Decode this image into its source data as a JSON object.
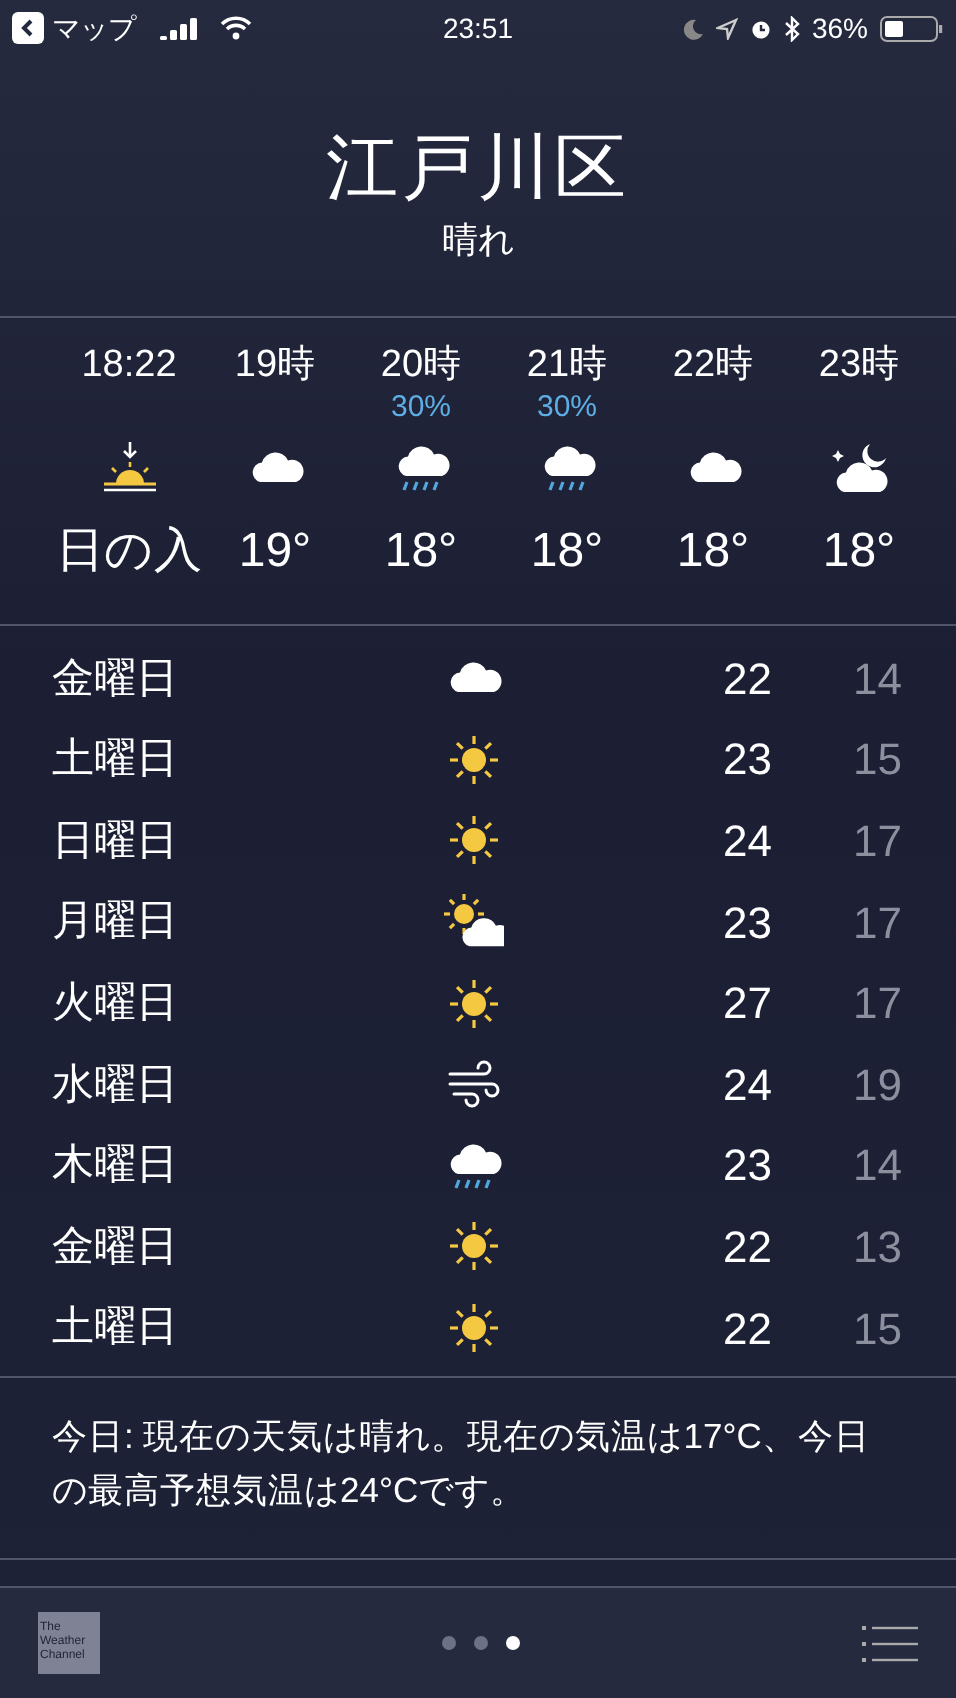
{
  "status_bar": {
    "back_label": "マップ",
    "time": "23:51",
    "battery": "36%"
  },
  "location": {
    "name": "江戸川区",
    "condition": "晴れ"
  },
  "hourly": [
    {
      "time": "18:22",
      "kind": "sunset",
      "label": "日の入"
    },
    {
      "time": "19時",
      "kind": "cloud",
      "label": "19°"
    },
    {
      "time": "20時",
      "kind": "rain",
      "label": "18°",
      "precip": "30%"
    },
    {
      "time": "21時",
      "kind": "rain",
      "label": "18°",
      "precip": "30%"
    },
    {
      "time": "22時",
      "kind": "cloud",
      "label": "18°"
    },
    {
      "time": "23時",
      "kind": "night_cloud",
      "label": "18°"
    }
  ],
  "daily": [
    {
      "day": "金曜日",
      "kind": "cloud",
      "high": "22",
      "low": "14"
    },
    {
      "day": "土曜日",
      "kind": "sun",
      "high": "23",
      "low": "15"
    },
    {
      "day": "日曜日",
      "kind": "sun",
      "high": "24",
      "low": "17"
    },
    {
      "day": "月曜日",
      "kind": "partly_sunny",
      "high": "23",
      "low": "17"
    },
    {
      "day": "火曜日",
      "kind": "sun",
      "high": "27",
      "low": "17"
    },
    {
      "day": "水曜日",
      "kind": "wind",
      "high": "24",
      "low": "19"
    },
    {
      "day": "木曜日",
      "kind": "rain",
      "high": "23",
      "low": "14"
    },
    {
      "day": "金曜日",
      "kind": "sun",
      "high": "22",
      "low": "13"
    },
    {
      "day": "土曜日",
      "kind": "sun",
      "high": "22",
      "low": "15"
    }
  ],
  "summary": "今日: 現在の天気は晴れ。現在の気温は17°C、今日の最高予想気温は24°Cです。",
  "bottom_bar": {
    "logo_lines": [
      "The",
      "Weather",
      "Channel"
    ],
    "pages": [
      {
        "selected": false
      },
      {
        "selected": false
      },
      {
        "selected": true
      }
    ]
  }
}
